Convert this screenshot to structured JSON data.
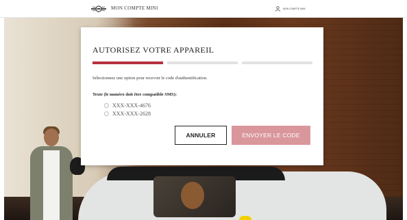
{
  "header": {
    "brand": "MON COMPTE MINI",
    "account_label": "MON COMPTE MINI",
    "logo_icon": "mini-wings-logo-icon",
    "account_icon": "user-icon"
  },
  "modal": {
    "title": "AUTORISEZ VOTRE APPAREIL",
    "steps": [
      {
        "state": "active"
      },
      {
        "state": "inactive"
      },
      {
        "state": "inactive"
      }
    ],
    "instruction": "Sélectionnez une option pour recevoir le code d'authentification.",
    "sms_group_label": "Texte (le numéro doit être compatible SMS):",
    "options": [
      {
        "label": "XXX-XXX-4676",
        "selected": false
      },
      {
        "label": "XXX-XXX-2628",
        "selected": false
      }
    ],
    "cancel_label": "ANNULER",
    "send_label": "ENVOYER LE CODE"
  },
  "colors": {
    "accent": "#b5323e",
    "send_button": "#d9969b",
    "step_inactive": "#e2e2e2"
  }
}
